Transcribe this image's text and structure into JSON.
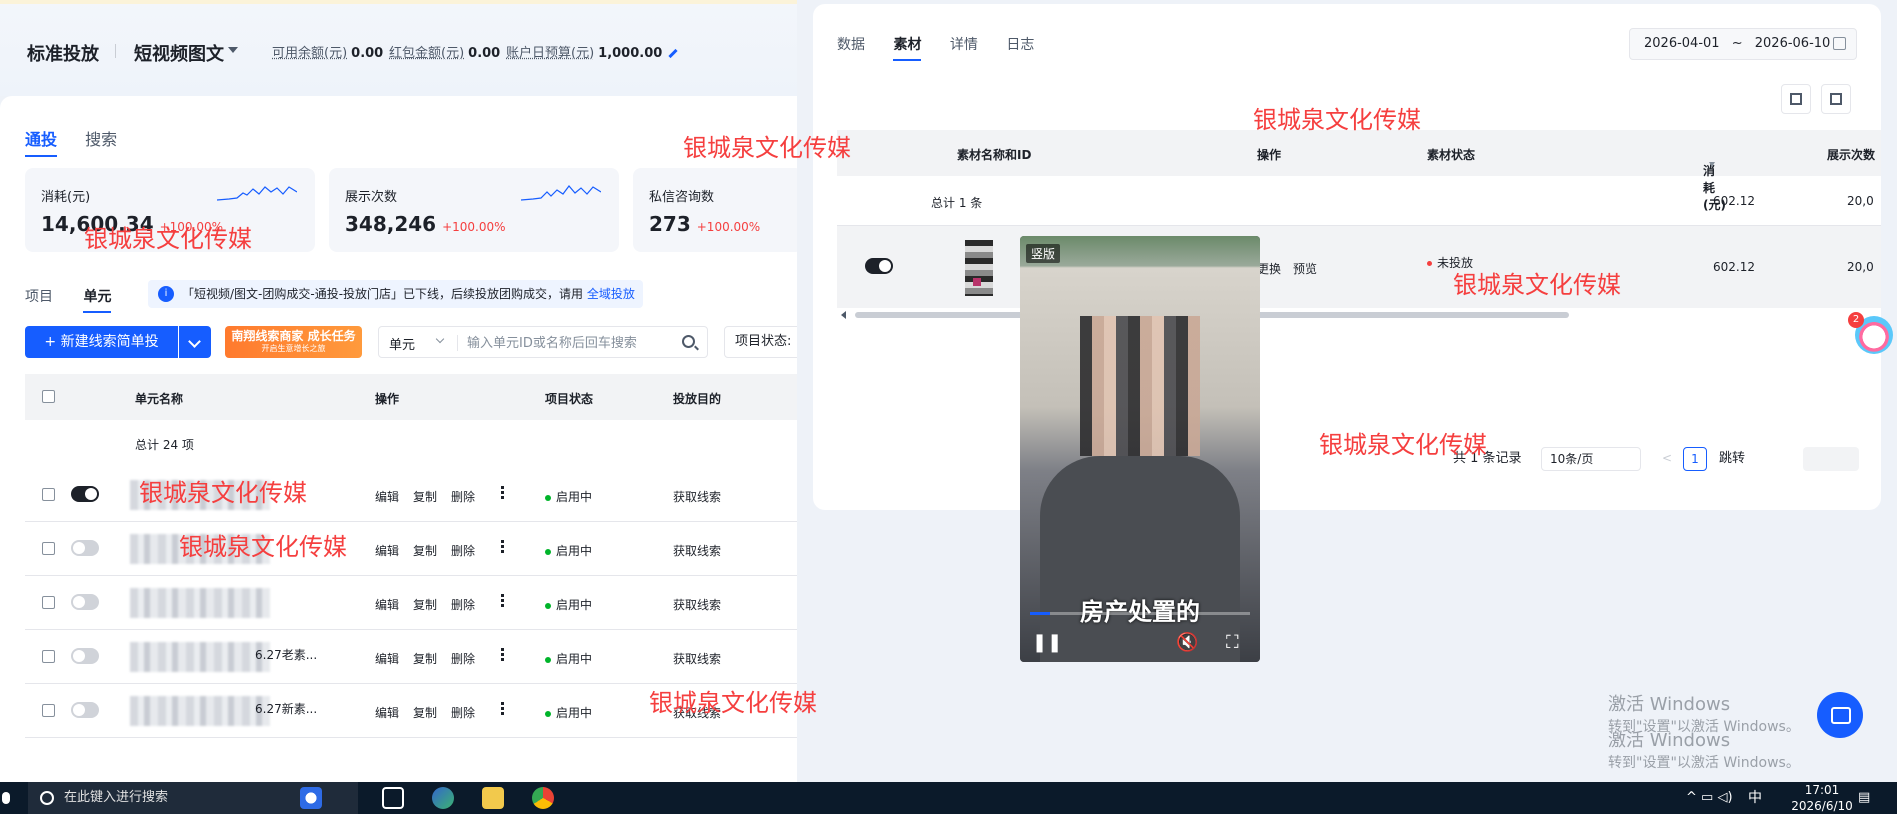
{
  "topbar": {
    "title": "标准投放",
    "mode": "短视频图文",
    "available_label": "可用余额(元)",
    "available_value": "0.00",
    "redpacket_label": "红包金额(元)",
    "redpacket_value": "0.00",
    "budget_label": "账户日预算(元)",
    "budget_value": "1,000.00"
  },
  "main_tabs": [
    "通投",
    "搜索"
  ],
  "cards": [
    {
      "label": "消耗(元)",
      "value": "14,600.34",
      "change": "+100.00%"
    },
    {
      "label": "展示次数",
      "value": "348,246",
      "change": "+100.00%"
    },
    {
      "label": "私信咨询数",
      "value": "273",
      "change": "+100.00%"
    }
  ],
  "sub_tabs": [
    "项目",
    "单元"
  ],
  "notice": {
    "text": "「短视频/图文-团购成交-通投-投放门店」已下线，后续投放团购成交，请用",
    "link": "全域投放"
  },
  "toolbar": {
    "new_button": "+ 新建线索简单投",
    "promo_title": "南翔线索商家 成长任务",
    "promo_sub": "开启生意增长之旅",
    "search_scope": "单元",
    "search_placeholder": "输入单元ID或名称后回车搜索",
    "filter_label": "项目状态:"
  },
  "table": {
    "headers": [
      "单元名称",
      "操作",
      "项目状态",
      "投放目的"
    ],
    "total": "总计 24 项",
    "ops": [
      "编辑",
      "复制",
      "删除"
    ],
    "rows": [
      {
        "name": "",
        "status": "启用中",
        "goal": "获取线索",
        "on": true
      },
      {
        "name": "",
        "status": "启用中",
        "goal": "获取线索",
        "on": false
      },
      {
        "name": "",
        "status": "启用中",
        "goal": "获取线索",
        "on": false
      },
      {
        "name": "6.27老素...",
        "status": "启用中",
        "goal": "获取线索",
        "on": false
      },
      {
        "name": "6.27新素...",
        "status": "启用中",
        "goal": "获取线索",
        "on": false
      }
    ]
  },
  "drawer": {
    "tabs": [
      "数据",
      "素材",
      "详情",
      "日志"
    ],
    "date_start": "2026-04-01",
    "date_sep": "~",
    "date_end": "2026-06-10",
    "headers": [
      "素材名称和ID",
      "操作",
      "素材状态",
      "消耗(元)",
      "展示次数"
    ],
    "total_label": "总计 1 条",
    "total_cost": "602.12",
    "total_impr": "20,0",
    "row": {
      "op1": "更换",
      "op2": "预览",
      "status": "未投放",
      "cost": "602.12",
      "impr": "20,0"
    },
    "pager": {
      "records": "共 1 条记录",
      "per_page": "10条/页",
      "prev": "<",
      "page": "1",
      "next": ">",
      "jump": "跳转"
    }
  },
  "video": {
    "tag": "竖版",
    "caption": "房产处置的",
    "play": "❚❚",
    "mute": "🔇",
    "fullscreen": "⛶"
  },
  "watermark": "银城泉文化传媒",
  "windows": {
    "activate": "激活 Windows",
    "hint": "转到\"设置\"以激活 Windows。"
  },
  "badge_count": "2",
  "taskbar": {
    "search": "在此键入进行搜索",
    "ime": "中",
    "time": "17:01",
    "date": "2026/6/10"
  }
}
